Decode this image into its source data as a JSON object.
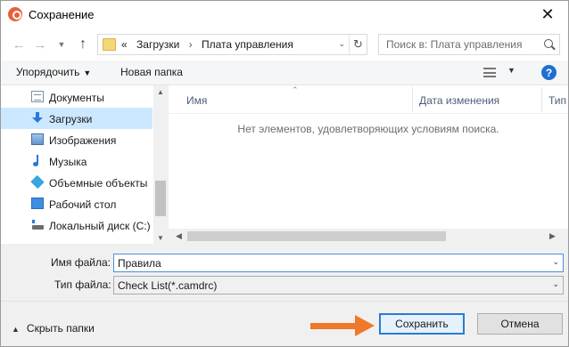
{
  "window": {
    "title": "Сохранение",
    "close_label": "✕"
  },
  "address_bar": {
    "overflow": "«",
    "path": [
      "Загрузки",
      "Плата управления"
    ],
    "separator": "›"
  },
  "search": {
    "placeholder": "Поиск в: Плата управления"
  },
  "toolbar": {
    "organize_label": "Упорядочить",
    "new_folder_label": "Новая папка",
    "help_label": "?"
  },
  "sidebar": {
    "items": [
      {
        "label": "Документы",
        "icon": "documents-icon"
      },
      {
        "label": "Загрузки",
        "icon": "downloads-icon",
        "selected": true
      },
      {
        "label": "Изображения",
        "icon": "pictures-icon"
      },
      {
        "label": "Музыка",
        "icon": "music-icon"
      },
      {
        "label": "Объемные объекты",
        "icon": "3d-objects-icon"
      },
      {
        "label": "Рабочий стол",
        "icon": "desktop-icon"
      },
      {
        "label": "Локальный диск (C:)",
        "icon": "local-disk-icon"
      }
    ]
  },
  "file_list": {
    "columns": [
      "Имя",
      "Дата изменения",
      "Тип"
    ],
    "empty_message": "Нет элементов, удовлетворяющих условиям поиска."
  },
  "form": {
    "filename_label": "Имя файла:",
    "filename_value": "Правила",
    "filetype_label": "Тип файла:",
    "filetype_value": "Check List(*.camdrc)"
  },
  "footer": {
    "hide_folders_label": "Скрыть папки",
    "save_label": "Сохранить",
    "cancel_label": "Отмена"
  },
  "colors": {
    "accent": "#2b7ad6",
    "selection": "#cce8ff",
    "pointer_arrow": "#f0782a"
  }
}
